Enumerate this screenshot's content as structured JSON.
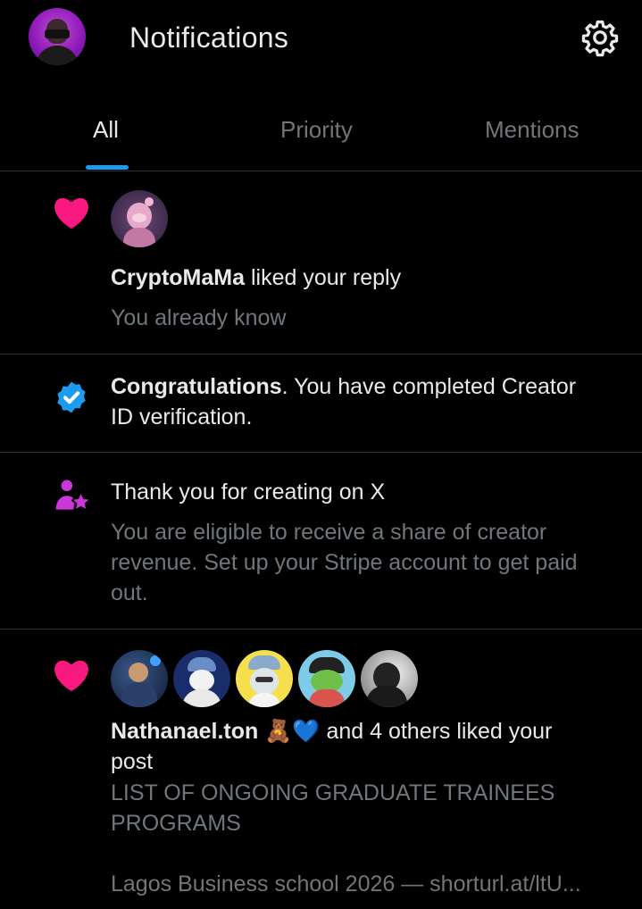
{
  "header": {
    "title": "Notifications",
    "avatar_icon": "profile-avatar",
    "settings_icon": "gear-icon"
  },
  "tabs": [
    {
      "label": "All",
      "active": true
    },
    {
      "label": "Priority",
      "active": false
    },
    {
      "label": "Mentions",
      "active": false
    }
  ],
  "colors": {
    "background": "#000000",
    "text": "#e7e9ea",
    "muted": "#71767b",
    "accent": "#1d9bf0",
    "like": "#f91880",
    "creator": "#c936d9",
    "divider": "#2f3336"
  },
  "notifications": [
    {
      "type": "like",
      "icon": "heart-icon",
      "user": "CryptoMaMa",
      "action": " liked your reply",
      "preview": "You already know"
    },
    {
      "type": "verification",
      "icon": "verified-badge-icon",
      "title": "Congratulations",
      "text_line1": ".  You have completed Creator",
      "text_line2": "ID verification."
    },
    {
      "type": "creator",
      "icon": "creator-star-person-icon",
      "title": "Thank you for creating on X",
      "body_line1": "You are eligible to receive a share of creator",
      "body_line2": "revenue. Set up your Stripe account to get paid",
      "body_line3": "out."
    },
    {
      "type": "like",
      "icon": "heart-icon",
      "user": "Nathanael.ton",
      "emoji": " 🧸💙",
      "action_line1": " and 4 others liked your",
      "action_line2": "post",
      "preview_line1": "LIST OF ONGOING GRADUATE TRAINEES",
      "preview_line2": "PROGRAMS",
      "preview_line3": "Lagos Business school 2026 — shorturl.at/ltU..."
    }
  ]
}
